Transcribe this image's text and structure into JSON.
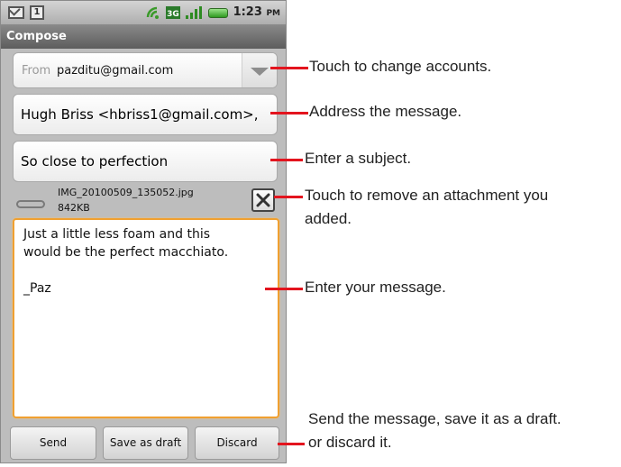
{
  "status_bar": {
    "time": "1:23",
    "time_suffix": "PM",
    "calendar_badge": "1",
    "icons": [
      "gmail-icon",
      "calendar-icon",
      "sync-icon",
      "3g-icon",
      "signal-icon",
      "battery-icon"
    ]
  },
  "title_bar": {
    "title": "Compose"
  },
  "compose": {
    "from_prefix": "From",
    "from_account": "pazditu@gmail.com",
    "to": "Hugh Briss <hbriss1@gmail.com>,",
    "subject": "So close to perfection",
    "attachment": {
      "name": "IMG_20100509_135052.jpg",
      "size": "842KB"
    },
    "body_lines": [
      "Just a little less foam and this",
      "would be the perfect macchiato.",
      "",
      "_Paz"
    ]
  },
  "buttons": {
    "send": "Send",
    "save_draft": "Save as draft",
    "discard": "Discard"
  },
  "callouts": {
    "change_account": "Touch to change accounts.",
    "address": "Address the message.",
    "subject": "Enter a subject.",
    "remove_attachment_1": "Touch to remove an attachment you",
    "remove_attachment_2": "added.",
    "message": "Enter your message.",
    "send_1": "Send the message, save it as a draft.",
    "send_2": "or discard it."
  },
  "colors": {
    "leader_line": "#e3141e",
    "focus_border": "#f0a030",
    "title_bar": "#6f6f6f"
  }
}
